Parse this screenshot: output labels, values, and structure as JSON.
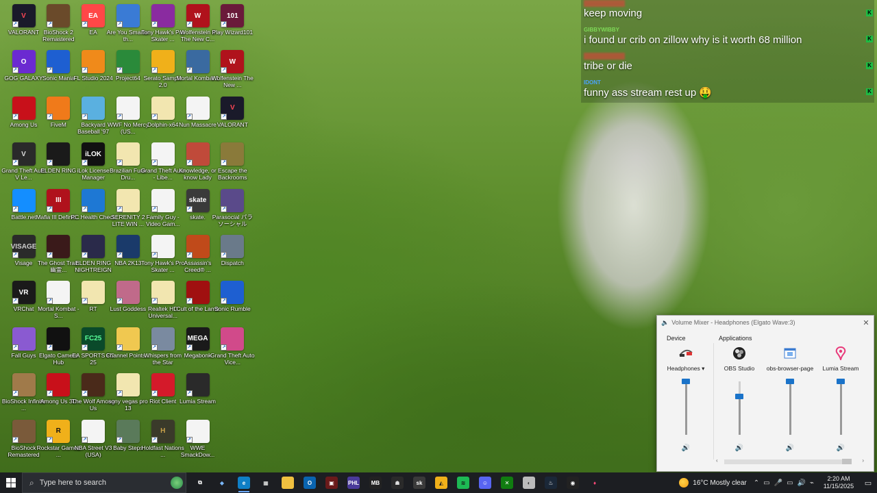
{
  "desktop_icons": [
    {
      "label": "VALORANT",
      "bg": "#1a1a2a",
      "glyph": "V",
      "fg": "#ff4655"
    },
    {
      "label": "BioShock 2 Remastered",
      "bg": "#6a4a2a",
      "glyph": "",
      "fg": "#fff"
    },
    {
      "label": "EA",
      "bg": "#ff4747",
      "glyph": "EA",
      "fg": "#fff"
    },
    {
      "label": "Are You Smarter th...",
      "bg": "#3a7bd5",
      "glyph": "",
      "fg": "#fff"
    },
    {
      "label": "Tony Hawk's Pro Skater ...",
      "bg": "#8a2ba0",
      "glyph": "",
      "fg": "#fff"
    },
    {
      "label": "Wolfenstein II The New C...",
      "bg": "#b0121c",
      "glyph": "W",
      "fg": "#fff"
    },
    {
      "label": "Play Wizard101",
      "bg": "#6a1a3a",
      "glyph": "101",
      "fg": "#fff"
    },
    {
      "label": "GOG GALAXY",
      "bg": "#6b2ad1",
      "glyph": "O",
      "fg": "#fff"
    },
    {
      "label": "Sonic Mania",
      "bg": "#1e5fd1",
      "glyph": "",
      "fg": "#fff"
    },
    {
      "label": "FL Studio 2024",
      "bg": "#f08a1a",
      "glyph": "",
      "fg": "#fff"
    },
    {
      "label": "Project64",
      "bg": "#2a8a3a",
      "glyph": "",
      "fg": "#fff"
    },
    {
      "label": "Serato Sample 2.0",
      "bg": "#f0b01a",
      "glyph": "",
      "fg": "#222"
    },
    {
      "label": "Mortal Kombat 1",
      "bg": "#3a6aa0",
      "glyph": "",
      "fg": "#fff"
    },
    {
      "label": "Wolfenstein The New ...",
      "bg": "#b0121c",
      "glyph": "W",
      "fg": "#fff"
    },
    {
      "label": "Among Us",
      "bg": "#c8101a",
      "glyph": "",
      "fg": "#fff"
    },
    {
      "label": "FiveM",
      "bg": "#f07a1a",
      "glyph": "",
      "fg": "#fff"
    },
    {
      "label": "Backyard Baseball '97",
      "bg": "#5ab0e0",
      "glyph": "",
      "fg": "#fff"
    },
    {
      "label": "WWF No Mercy (US...",
      "bg": "#f4f4f4",
      "glyph": "",
      "fg": "#333"
    },
    {
      "label": "Dolphin-x64",
      "bg": "#f2e6b0",
      "glyph": "",
      "fg": "#333"
    },
    {
      "label": "Nun Massacre",
      "bg": "#f4f4f4",
      "glyph": "",
      "fg": "#333"
    },
    {
      "label": "VALORANT",
      "bg": "#1a1a2a",
      "glyph": "V",
      "fg": "#ff4655"
    },
    {
      "label": "Grand Theft Auto V Le...",
      "bg": "#2a2a2a",
      "glyph": "V",
      "fg": "#ddd"
    },
    {
      "label": "ELDEN RING",
      "bg": "#1a1a1a",
      "glyph": "",
      "fg": "#c9a24a"
    },
    {
      "label": "iLok License Manager",
      "bg": "#111",
      "glyph": "iLOK",
      "fg": "#fff"
    },
    {
      "label": "Brazilian Funk Dru...",
      "bg": "#f2e6b0",
      "glyph": "",
      "fg": "#333"
    },
    {
      "label": "Grand Theft Auto - Libe...",
      "bg": "#f4f4f4",
      "glyph": "",
      "fg": "#333"
    },
    {
      "label": "Knowledge, or know Lady",
      "bg": "#c04a3a",
      "glyph": "",
      "fg": "#fff"
    },
    {
      "label": "Escape the Backrooms",
      "bg": "#8a7a3a",
      "glyph": "",
      "fg": "#fff"
    },
    {
      "label": "Battle.net",
      "bg": "#148eff",
      "glyph": "",
      "fg": "#fff"
    },
    {
      "label": "Mafia III Definiti...",
      "bg": "#b0121c",
      "glyph": "III",
      "fg": "#fff"
    },
    {
      "label": "PC Health Check",
      "bg": "#1e78d4",
      "glyph": "",
      "fg": "#fff"
    },
    {
      "label": "SERENITY 2 LITE WIN ...",
      "bg": "#f2e6b0",
      "glyph": "",
      "fg": "#333"
    },
    {
      "label": "Family Guy - Video Gam...",
      "bg": "#f4f4f4",
      "glyph": "",
      "fg": "#333"
    },
    {
      "label": "skate.",
      "bg": "#3a3a3a",
      "glyph": "skate",
      "fg": "#fff"
    },
    {
      "label": "Parasocial パラソーシャル",
      "bg": "#5a4a8a",
      "glyph": "",
      "fg": "#fff"
    },
    {
      "label": "Visage",
      "bg": "#2a2a2a",
      "glyph": "VISAGE",
      "fg": "#ccc"
    },
    {
      "label": "The Ghost Train 幽霊...",
      "bg": "#3a1a1a",
      "glyph": "",
      "fg": "#fff"
    },
    {
      "label": "ELDEN RING NIGHTREIGN",
      "bg": "#2a2a4a",
      "glyph": "",
      "fg": "#fff"
    },
    {
      "label": "NBA 2K13",
      "bg": "#1a3a6a",
      "glyph": "",
      "fg": "#fff"
    },
    {
      "label": "Tony Hawk's Pro Skater ...",
      "bg": "#f4f4f4",
      "glyph": "",
      "fg": "#333"
    },
    {
      "label": "Assassin's Creed® ...",
      "bg": "#c04a1a",
      "glyph": "",
      "fg": "#fff"
    },
    {
      "label": "Dispatch",
      "bg": "#6a7a8a",
      "glyph": "",
      "fg": "#fff"
    },
    {
      "label": "VRChat",
      "bg": "#1a1a1a",
      "glyph": "VR",
      "fg": "#fff"
    },
    {
      "label": "Mortal Kombat - S...",
      "bg": "#f4f4f4",
      "glyph": "",
      "fg": "#333"
    },
    {
      "label": "RT",
      "bg": "#f2e6b0",
      "glyph": "",
      "fg": "#333"
    },
    {
      "label": "Lust Goddess",
      "bg": "#c06a8a",
      "glyph": "",
      "fg": "#fff"
    },
    {
      "label": "Realtek HD Universal...",
      "bg": "#f2e6b0",
      "glyph": "",
      "fg": "#333"
    },
    {
      "label": "Cult of the Lamb",
      "bg": "#a01010",
      "glyph": "",
      "fg": "#fff"
    },
    {
      "label": "Sonic Rumble",
      "bg": "#1e5fd1",
      "glyph": "",
      "fg": "#fff"
    },
    {
      "label": "Fall Guys",
      "bg": "#8a5ad1",
      "glyph": "",
      "fg": "#fff"
    },
    {
      "label": "Elgato Camera Hub",
      "bg": "#111",
      "glyph": "",
      "fg": "#fff"
    },
    {
      "label": "EA SPORTS FC 25",
      "bg": "#0a4a2a",
      "glyph": "FC25",
      "fg": "#5aff9a"
    },
    {
      "label": "Channel Points...",
      "bg": "#f0c850",
      "glyph": "",
      "fg": "#333"
    },
    {
      "label": "Whispers from the Star",
      "bg": "#7a8aa0",
      "glyph": "",
      "fg": "#fff"
    },
    {
      "label": "Megabonk",
      "bg": "#1a1a1a",
      "glyph": "MEGA",
      "fg": "#fff"
    },
    {
      "label": "Grand Theft Auto Vice...",
      "bg": "#d14a8a",
      "glyph": "",
      "fg": "#fff"
    },
    {
      "label": "BioShock Infinite ...",
      "bg": "#a07a4a",
      "glyph": "",
      "fg": "#fff"
    },
    {
      "label": "Among Us 3D",
      "bg": "#c8101a",
      "glyph": "",
      "fg": "#fff"
    },
    {
      "label": "The Wolf Among Us",
      "bg": "#4a2a1a",
      "glyph": "",
      "fg": "#fff"
    },
    {
      "label": "sony vegas pro 13",
      "bg": "#f2e6b0",
      "glyph": "",
      "fg": "#333"
    },
    {
      "label": "Riot Client",
      "bg": "#d41a2a",
      "glyph": "",
      "fg": "#fff"
    },
    {
      "label": "Lumia Stream",
      "bg": "#2a2a2a",
      "glyph": "",
      "fg": "#ff4a7a"
    },
    {
      "label": "BioShock Remastered",
      "bg": "#7a5a3a",
      "glyph": "",
      "fg": "#fff"
    },
    {
      "label": "Rockstar Games ...",
      "bg": "#f0b01a",
      "glyph": "R",
      "fg": "#111"
    },
    {
      "label": "NBA Street V3 (USA)",
      "bg": "#f4f4f4",
      "glyph": "",
      "fg": "#333"
    },
    {
      "label": "Baby Steps",
      "bg": "#5a7a5a",
      "glyph": "",
      "fg": "#fff"
    },
    {
      "label": "Holdfast Nations ...",
      "bg": "#3a3a2a",
      "glyph": "H",
      "fg": "#c9a24a"
    },
    {
      "label": "WWE SmackDow...",
      "bg": "#f4f4f4",
      "glyph": "",
      "fg": "#333"
    }
  ],
  "chat": {
    "messages": [
      {
        "user": "",
        "user_color": "#e0403a",
        "text": "keep moving"
      },
      {
        "user": "GIBBYWIBBY",
        "user_color": "#7ed957",
        "text": "i found ur crib on zillow why is it worth 68 million"
      },
      {
        "user": "",
        "user_color": "#e0403a",
        "text": "tribe or die"
      },
      {
        "user": "IDONT",
        "user_color": "#4aa3ff",
        "text": "funny ass stream rest up 🤑"
      }
    ],
    "badge_glyph": "K"
  },
  "mixer": {
    "title": "Volume Mixer - Headphones (Elgato Wave:3)",
    "close_glyph": "✕",
    "device_label": "Device",
    "applications_label": "Applications",
    "channels": [
      {
        "name": "Headphones ▾",
        "level": 1.0,
        "icon": "headphones-icon"
      },
      {
        "name": "OBS Studio",
        "level": 0.72,
        "icon": "obs-icon"
      },
      {
        "name": "obs-browser-page",
        "level": 1.0,
        "icon": "browser-page-icon"
      },
      {
        "name": "Lumia Stream",
        "level": 1.0,
        "icon": "lumia-icon"
      }
    ],
    "speaker_glyph": "🔊",
    "scroll_left": "‹",
    "scroll_right": "›"
  },
  "taskbar": {
    "search_placeholder": "Type here to search",
    "weather": "16°C  Mostly clear",
    "time": "2:20 AM",
    "date": "11/15/2025",
    "apps": [
      {
        "name": "taskview-icon",
        "glyph": "⧉",
        "bg": "transparent",
        "fg": "#fff"
      },
      {
        "name": "copilot-icon",
        "glyph": "◆",
        "bg": "transparent",
        "fg": "#7ab8ff"
      },
      {
        "name": "edge-icon",
        "glyph": "e",
        "bg": "#0f7fc6",
        "fg": "#fff"
      },
      {
        "name": "store-icon",
        "glyph": "▦",
        "bg": "transparent",
        "fg": "#fff"
      },
      {
        "name": "file-explorer-icon",
        "glyph": "▬",
        "bg": "#f0c040",
        "fg": "#f0c040"
      },
      {
        "name": "outlook-icon",
        "glyph": "O",
        "bg": "#0a64b0",
        "fg": "#fff"
      },
      {
        "name": "game-app-icon",
        "glyph": "▣",
        "bg": "#6a1a1a",
        "fg": "#fff"
      },
      {
        "name": "phil-app-icon",
        "glyph": "PHL",
        "bg": "#4a3a9a",
        "fg": "#fff"
      },
      {
        "name": "megabonk-app-icon",
        "glyph": "MB",
        "bg": "#222",
        "fg": "#fff"
      },
      {
        "name": "figure-app-icon",
        "glyph": "☗",
        "bg": "#2a2a2a",
        "fg": "#ddd"
      },
      {
        "name": "skate-app-icon",
        "glyph": "sk",
        "bg": "#3a3a3a",
        "fg": "#fff"
      },
      {
        "name": "serato-app-icon",
        "glyph": "◭",
        "bg": "#f0b01a",
        "fg": "#222"
      },
      {
        "name": "spotify-icon",
        "glyph": "≋",
        "bg": "#1db954",
        "fg": "#111"
      },
      {
        "name": "discord-icon",
        "glyph": "☺",
        "bg": "#5865f2",
        "fg": "#fff"
      },
      {
        "name": "xbox-icon",
        "glyph": "✕",
        "bg": "#107c10",
        "fg": "#fff"
      },
      {
        "name": "media-app-icon",
        "glyph": "◐",
        "bg": "#bbb",
        "fg": "#333"
      },
      {
        "name": "steam-icon",
        "glyph": "♨",
        "bg": "#1b2838",
        "fg": "#fff"
      },
      {
        "name": "obs-taskbar-icon",
        "glyph": "◉",
        "bg": "#222",
        "fg": "#fff"
      },
      {
        "name": "lumia-taskbar-icon",
        "glyph": "♦",
        "bg": "transparent",
        "fg": "#ff4a7a"
      }
    ],
    "tray": [
      "⌃",
      "▭",
      "🎤",
      "▭",
      "🔊",
      "⌁"
    ]
  }
}
